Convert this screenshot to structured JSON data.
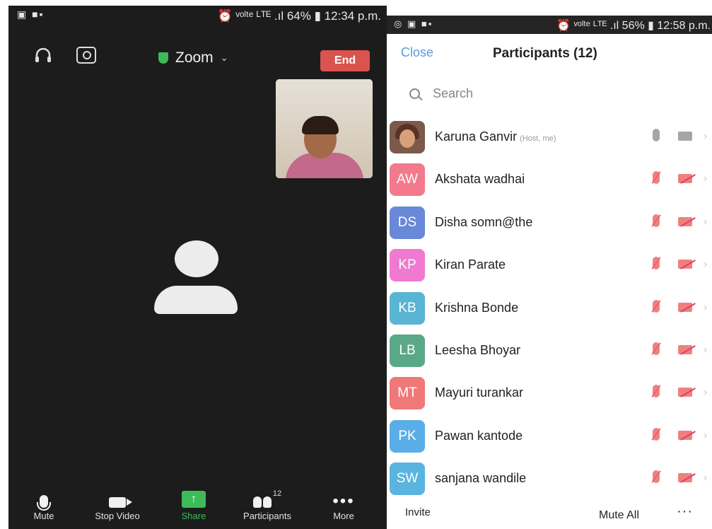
{
  "meeting": {
    "status": {
      "left_icons": "▣ ■▪",
      "right": "⏰ ᵛᵒˡᵗᵉ ᴸᵀᴱ .ıl 64% ▮ 12:34 p.m."
    },
    "title": "Zoom",
    "end_label": "End",
    "toolbar": {
      "mute": "Mute",
      "stop_video": "Stop Video",
      "share": "Share",
      "participants": "Participants",
      "participants_count": "12",
      "more": "More"
    },
    "colors": {
      "end": "#d9534f",
      "share": "#3dbb5a",
      "background": "#1c1c1c"
    }
  },
  "participants_panel": {
    "status": {
      "left_icons": "◎ ▣ ■▪",
      "right": "⏰ ᵛᵒˡᵗᵉ ᴸᵀᴱ .ıl 56% ▮ 12:58 p.m."
    },
    "close_label": "Close",
    "title": "Participants (12)",
    "search_placeholder": "Search",
    "rows": [
      {
        "initials": "",
        "name": "Karuna Ganvir",
        "tag": "(Host, me)",
        "color": "#7b5a4a",
        "muted": false,
        "video_off": false,
        "photo": true
      },
      {
        "initials": "AW",
        "name": "Akshata wadhai",
        "tag": "",
        "color": "#f27a8c",
        "muted": true,
        "video_off": true
      },
      {
        "initials": "DS",
        "name": "Disha somn@the",
        "tag": "",
        "color": "#6a88d8",
        "muted": true,
        "video_off": true
      },
      {
        "initials": "KP",
        "name": "Kiran Parate",
        "tag": "",
        "color": "#f07ad0",
        "muted": true,
        "video_off": true
      },
      {
        "initials": "KB",
        "name": "Krishna Bonde",
        "tag": "",
        "color": "#5ab4d4",
        "muted": true,
        "video_off": true
      },
      {
        "initials": "LB",
        "name": "Leesha Bhoyar",
        "tag": "",
        "color": "#5aa888",
        "muted": true,
        "video_off": true
      },
      {
        "initials": "MT",
        "name": "Mayuri turankar",
        "tag": "",
        "color": "#f07878",
        "muted": true,
        "video_off": true
      },
      {
        "initials": "PK",
        "name": "Pawan kantode",
        "tag": "",
        "color": "#5aaee8",
        "muted": true,
        "video_off": true
      },
      {
        "initials": "SW",
        "name": "sanjana wandile",
        "tag": "",
        "color": "#5ab4e0",
        "muted": true,
        "video_off": true
      }
    ],
    "footer": {
      "invite": "Invite",
      "mute_all": "Mute All",
      "more": "···"
    }
  }
}
